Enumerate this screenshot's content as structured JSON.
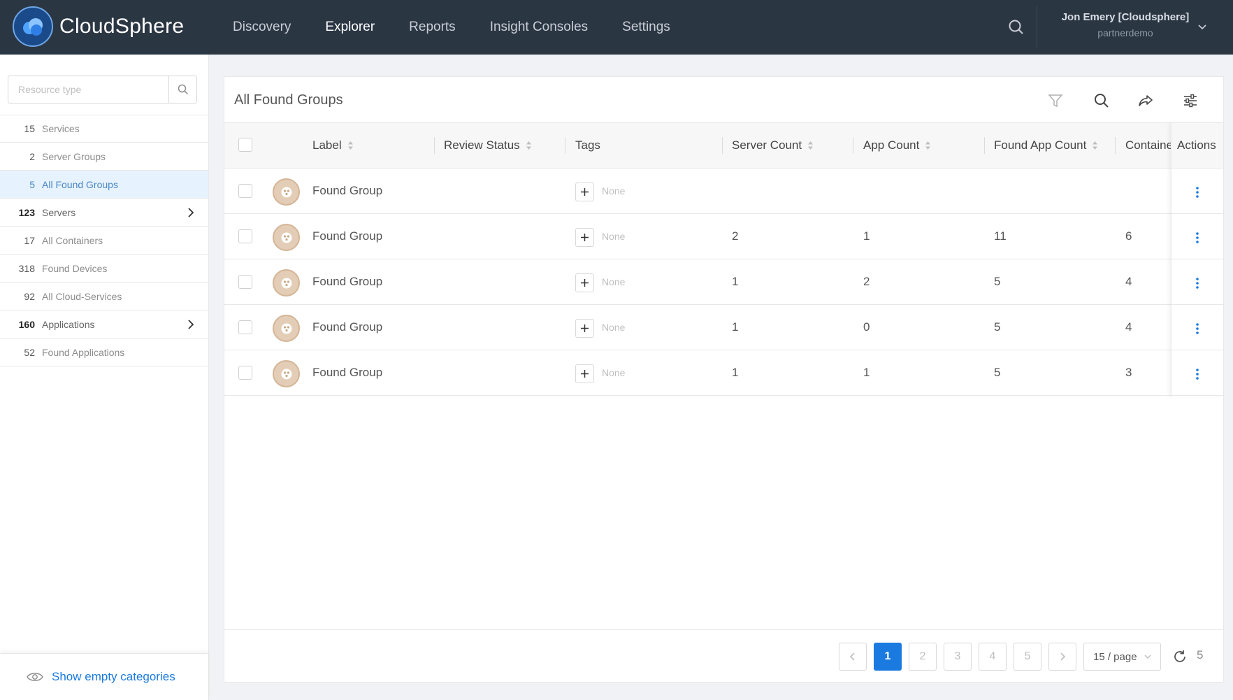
{
  "header": {
    "app_name": "CloudSphere",
    "nav": [
      "Discovery",
      "Explorer",
      "Reports",
      "Insight Consoles",
      "Settings"
    ],
    "active_nav": "Explorer",
    "user_name": "Jon Emery [Cloudsphere]",
    "user_org": "partnerdemo"
  },
  "sidebar": {
    "search_placeholder": "Resource type",
    "categories": [
      {
        "count": "15",
        "label": "Services",
        "bold": false,
        "expandable": false,
        "selected": false
      },
      {
        "count": "2",
        "label": "Server Groups",
        "bold": false,
        "expandable": false,
        "selected": false
      },
      {
        "count": "5",
        "label": "All Found Groups",
        "bold": false,
        "expandable": false,
        "selected": true
      },
      {
        "count": "123",
        "label": "Servers",
        "bold": true,
        "expandable": true,
        "selected": false
      },
      {
        "count": "17",
        "label": "All Containers",
        "bold": false,
        "expandable": false,
        "selected": false
      },
      {
        "count": "318",
        "label": "Found Devices",
        "bold": false,
        "expandable": false,
        "selected": false
      },
      {
        "count": "92",
        "label": "All Cloud-Services",
        "bold": false,
        "expandable": false,
        "selected": false
      },
      {
        "count": "160",
        "label": "Applications",
        "bold": true,
        "expandable": true,
        "selected": false
      },
      {
        "count": "52",
        "label": "Found Applications",
        "bold": false,
        "expandable": false,
        "selected": false
      }
    ],
    "show_empty_label": "Show empty categories"
  },
  "panel": {
    "title": "All Found Groups",
    "columns": {
      "label": "Label",
      "review_status": "Review Status",
      "tags": "Tags",
      "server_count": "Server Count",
      "app_count": "App Count",
      "found_app_count": "Found App Count",
      "containers": "Containe",
      "actions": "Actions"
    },
    "rows": [
      {
        "label": "Found Group",
        "tags": "None",
        "server_count": "",
        "app_count": "",
        "found_app_count": "",
        "containers": ""
      },
      {
        "label": "Found Group",
        "tags": "None",
        "server_count": "2",
        "app_count": "1",
        "found_app_count": "11",
        "containers": "6"
      },
      {
        "label": "Found Group",
        "tags": "None",
        "server_count": "1",
        "app_count": "2",
        "found_app_count": "5",
        "containers": "4"
      },
      {
        "label": "Found Group",
        "tags": "None",
        "server_count": "1",
        "app_count": "0",
        "found_app_count": "5",
        "containers": "4"
      },
      {
        "label": "Found Group",
        "tags": "None",
        "server_count": "1",
        "app_count": "1",
        "found_app_count": "5",
        "containers": "3"
      }
    ]
  },
  "pagination": {
    "pages": [
      "1",
      "2",
      "3",
      "4",
      "5"
    ],
    "current": "1",
    "page_size": "15 / page",
    "total": "5"
  },
  "colors": {
    "topbar": "#2b3643",
    "accent": "#1a7ae0",
    "selected_bg": "#e6f2fd"
  }
}
